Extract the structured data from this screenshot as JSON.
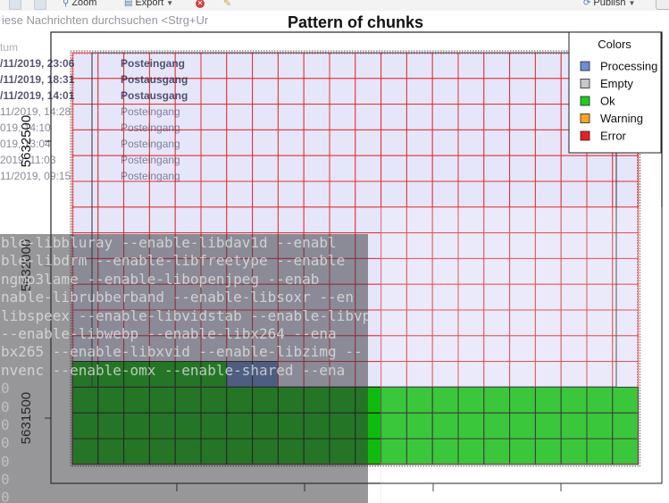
{
  "toolbar": {
    "zoom_label": "Zoom",
    "export_label": "Export",
    "publish_label": "Publish",
    "zoom_icon": "magnifier-icon",
    "export_icon": "export-icon",
    "publish_icon": "publish-icon",
    "stop_icon": "stop-icon",
    "brush_icon": "brush-icon"
  },
  "background_ghost": {
    "search_text": "iese Nachrichten durchsuchen <Strg+Ur",
    "list_header": "tum",
    "list_rows": [
      {
        "date": "/11/2019, 23:06",
        "folder": "Posteingang",
        "bold": true
      },
      {
        "date": "/11/2019, 18:31",
        "folder": "Postausgang",
        "bold": true
      },
      {
        "date": "/11/2019, 14:01",
        "folder": "Postausgang",
        "bold": true
      },
      {
        "date": "11/2019, 14:28",
        "folder": "Posteingang",
        "bold": false
      },
      {
        "date": "019, 14:10",
        "folder": "Posteingang",
        "bold": false
      },
      {
        "date": "019, 13:04",
        "folder": "Posteingang",
        "bold": false
      },
      {
        "date": "2019, 11:03",
        "folder": "Posteingang",
        "bold": false
      },
      {
        "date": "11/2019, 09:15",
        "folder": "Posteingang",
        "bold": false
      }
    ],
    "terminal_lines": [
      "ble-libbluray --enable-libdav1d --enabl",
      "ble-libdrm --enable-libfreetype --enable",
      "ngmp3lame --enable-libopenjpeg --enab",
      "nable-librubberband --enable-libsoxr --en",
      "libspeex --enable-libvidstab --enable-libvp",
      "--enable-libwebp --enable-libx264 --ena",
      "bx265 --enable-libxvid --enable-libzimg --",
      "nvenc --enable-omx --enable-shared --ena",
      "0",
      "0",
      "0",
      "0",
      "0",
      "0",
      "0"
    ]
  },
  "chart_data": {
    "type": "heatmap",
    "title": "Pattern of chunks",
    "xlabel": "",
    "ylabel": "",
    "y_ticks": [
      5631500,
      5632000,
      5632500
    ],
    "grid": {
      "rows": 16,
      "cols": 22,
      "status_by_row_from_top": [
        "Empty",
        "Empty",
        "Empty",
        "Empty",
        "Empty",
        "Empty",
        "Empty",
        "Empty",
        "Empty",
        "Empty",
        "Empty",
        "Empty",
        "Empty",
        "Ok",
        "Ok",
        "Ok"
      ],
      "row_13_detail": {
        "Ok": [
          0,
          1,
          2,
          3,
          4,
          5
        ],
        "Processing": [
          6,
          7
        ],
        "Empty": [
          8,
          9,
          10,
          11,
          12,
          13,
          14,
          15,
          16,
          17,
          18,
          19,
          20,
          21
        ]
      },
      "rows_from_top_status": {
        "13": "mixed",
        "14": "Ok",
        "15": "Ok",
        "16": "Ok"
      }
    },
    "legend": {
      "title": "Colors",
      "position": "top-right",
      "entries": [
        {
          "label": "Processing",
          "color": "#6b8fd4"
        },
        {
          "label": "Empty",
          "color": "#c8c8c8"
        },
        {
          "label": "Ok",
          "color": "#1fcc1f"
        },
        {
          "label": "Warning",
          "color": "#f5a623"
        },
        {
          "label": "Error",
          "color": "#e8202a"
        }
      ]
    },
    "cell_colors": {
      "empty_fill": "#e6e6fa",
      "empty_border": "#e03030",
      "ok_fill": "#10bb10",
      "ok_border": "#111111",
      "processing_fill": "#6688cc"
    }
  }
}
